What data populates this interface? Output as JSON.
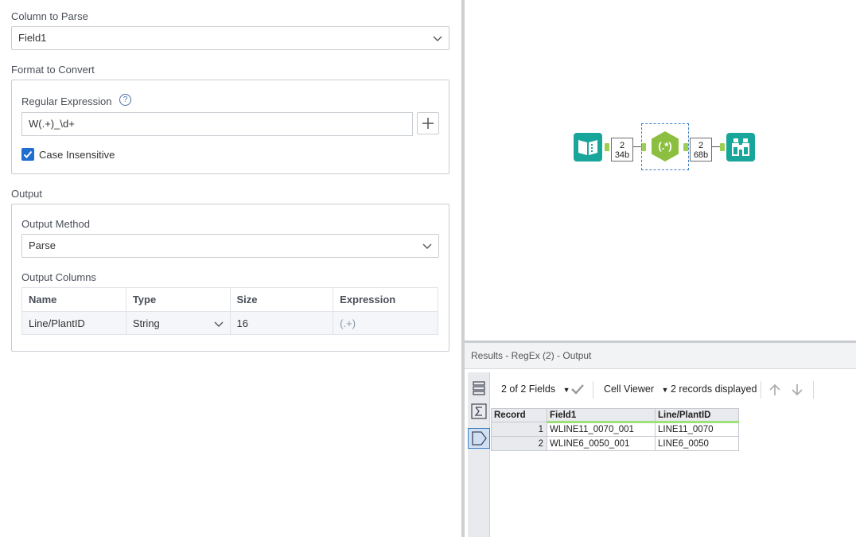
{
  "config": {
    "column_to_parse": {
      "label": "Column to Parse",
      "value": "Field1"
    },
    "format_to_convert": {
      "label": "Format to Convert",
      "regex_label": "Regular Expression",
      "help_glyph": "?",
      "regex_value": "W(.+)_\\d+",
      "case_insensitive_label": "Case Insensitive",
      "case_insensitive": true
    },
    "output": {
      "label": "Output",
      "method_label": "Output Method",
      "method_value": "Parse",
      "columns_label": "Output Columns",
      "columns_headers": [
        "Name",
        "Type",
        "Size",
        "Expression"
      ],
      "columns_rows": [
        {
          "name": "Line/PlantID",
          "type": "String",
          "size": "16",
          "expression": "(.+)"
        }
      ]
    }
  },
  "canvas": {
    "counts": [
      {
        "records": "2",
        "bytes": "34b"
      },
      {
        "records": "2",
        "bytes": "68b"
      }
    ],
    "regex_tool_glyph": "(.*)",
    "colors": {
      "tool": "#19a69a",
      "regex": "#8cbf3f",
      "anchor": "#9ccf51"
    }
  },
  "results": {
    "title": "Results - RegEx (2) - Output",
    "fields_selector": "2 of 2 Fields",
    "viewer": "Cell Viewer",
    "records_displayed": "2 records displayed",
    "headers": [
      "Record",
      "Field1",
      "Line/PlantID"
    ],
    "rows": [
      {
        "record": "1",
        "field1": "WLINE11_0070_001",
        "plant": "LINE11_0070"
      },
      {
        "record": "2",
        "field1": "WLINE6_0050_001",
        "plant": "LINE6_0050"
      }
    ]
  }
}
